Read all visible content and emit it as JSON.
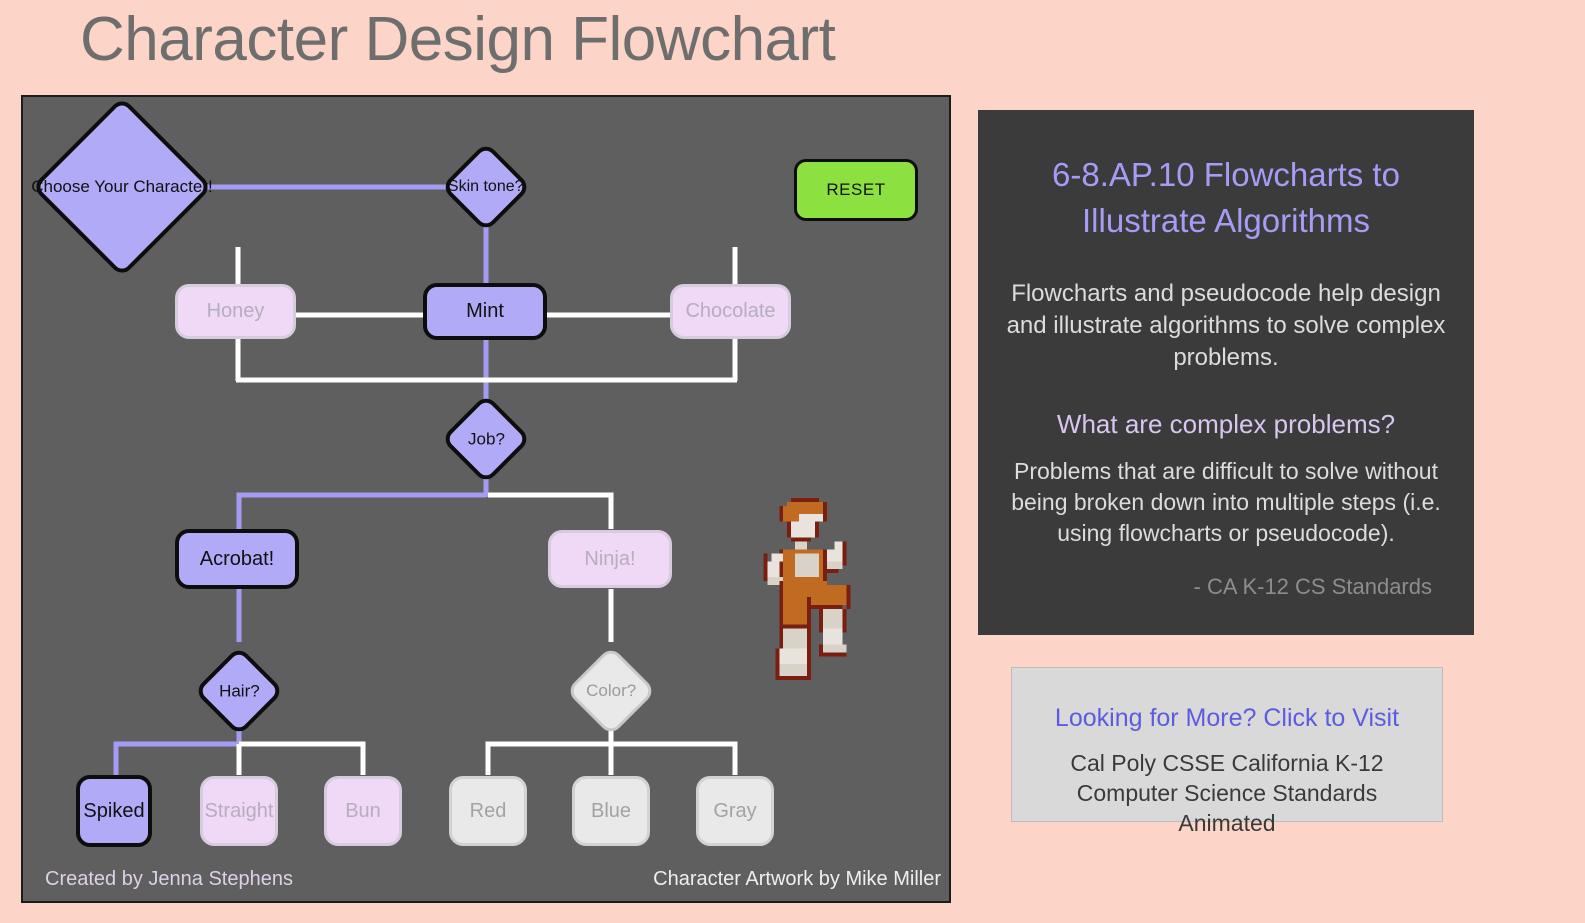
{
  "page": {
    "title": "Character Design Flowchart",
    "background_color": "#fcd5c8"
  },
  "flowchart": {
    "canvas_color": "#5f5f5f",
    "selected_color": "#b0aaf7",
    "unselected_pink": "#efd9f7",
    "unselected_gray": "#e9e9e9",
    "reset_button": {
      "label": "RESET",
      "color": "#8ce040"
    },
    "nodes": {
      "start": "Choose Your Character!",
      "skin_tone": "Skin tone?",
      "honey": "Honey",
      "mint": "Mint",
      "chocolate": "Chocolate",
      "job": "Job?",
      "acrobat": "Acrobat!",
      "ninja": "Ninja!",
      "hair": "Hair?",
      "color": "Color?",
      "spiked": "Spiked",
      "straight": "Straight",
      "bun": "Bun",
      "red": "Red",
      "blue": "Blue",
      "gray": "Gray"
    },
    "selections": {
      "skin_tone": "Mint",
      "job": "Acrobat!",
      "hair": "Spiked"
    },
    "credits": {
      "author": "Created by Jenna Stephens",
      "artwork": "Character Artwork by Mike Miller"
    }
  },
  "standards_panel": {
    "heading": "6-8.AP.10 Flowcharts to Illustrate Algorithms",
    "body": "Flowcharts and pseudocode help design and illustrate algorithms to solve complex problems.",
    "question": "What are complex problems?",
    "answer": "Problems that are difficult to solve without being broken down into multiple steps (i.e. using flowcharts or pseudocode).",
    "source": "- CA K-12 CS Standards"
  },
  "link_card": {
    "title": "Looking for More? Click to Visit",
    "subtitle": "Cal Poly CSSE California K-12 Computer Science Standards Animated"
  }
}
